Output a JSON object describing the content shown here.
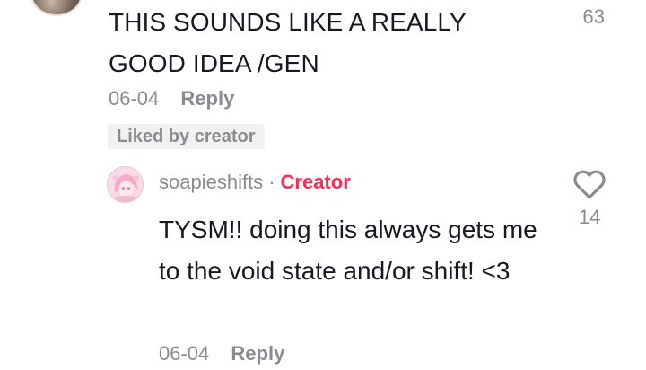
{
  "parent_comment": {
    "text": "THIS SOUNDS LIKE A REALLY GOOD IDEA /GEN",
    "like_count": "63",
    "date": "06-04",
    "reply_label": "Reply",
    "liked_by_creator": "Liked by creator"
  },
  "reply_comment": {
    "username": "soapieshifts",
    "separator": "·",
    "badge": "Creator",
    "text": "TYSM!! doing this always gets me to the void state and/or shift! <3",
    "like_count": "14",
    "date": "06-04",
    "reply_label": "Reply",
    "like_icon": "heart-outline-icon"
  },
  "colors": {
    "text": "#161823",
    "muted": "#8a8b91",
    "creator_badge": "#fe2c55",
    "chip_bg": "#f1f1f2"
  }
}
